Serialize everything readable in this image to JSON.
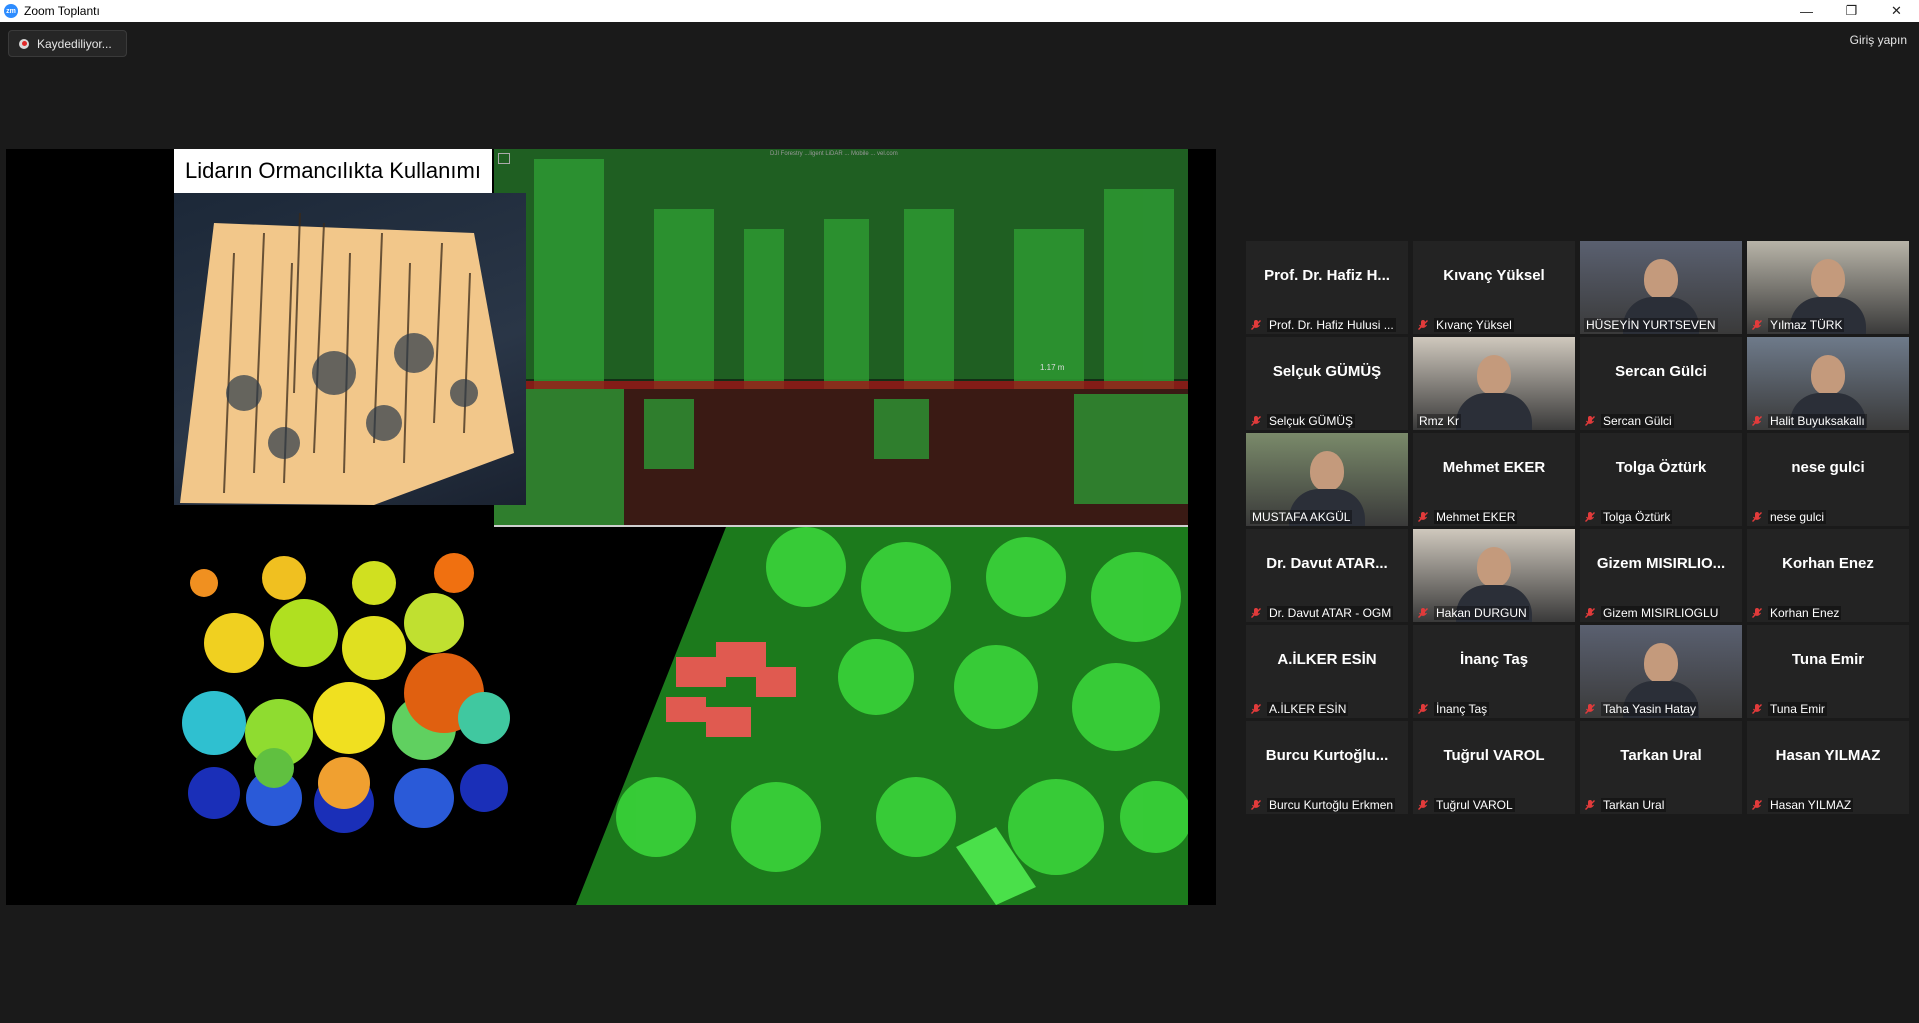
{
  "window": {
    "title": "Zoom Toplantı",
    "logo_text": "zm"
  },
  "window_controls": {
    "minimize": "—",
    "restore": "❐",
    "close": "✕"
  },
  "topbar": {
    "recording_label": "Kaydediliyor...",
    "signin_label": "Giriş yapın"
  },
  "share": {
    "slide_title": "Lidarın Ormancılıkta Kullanımı",
    "measure_label": "1.17 m",
    "top_caption": "DJI Forestry ...ligent LiDAR ... Mobile ... vel.com"
  },
  "participants": [
    {
      "display": "Prof. Dr. Hafiz H...",
      "name": "Prof. Dr. Hafiz Hulusi ...",
      "video": false,
      "muted": true
    },
    {
      "display": "Kıvanç Yüksel",
      "name": "Kıvanç Yüksel",
      "video": false,
      "muted": true
    },
    {
      "display": "",
      "name": "HÜSEYİN YURTSEVEN",
      "video": true,
      "muted": false,
      "speaking": true
    },
    {
      "display": "",
      "name": "Yılmaz TÜRK",
      "video": true,
      "muted": true
    },
    {
      "display": "Selçuk GÜMÜŞ",
      "name": "Selçuk GÜMÜŞ",
      "video": false,
      "muted": true
    },
    {
      "display": "",
      "name": "Rmz Kr",
      "video": true,
      "muted": false
    },
    {
      "display": "Sercan Gülci",
      "name": "Sercan Gülci",
      "video": false,
      "muted": true
    },
    {
      "display": "",
      "name": "Halit Buyuksakallı",
      "video": true,
      "muted": true
    },
    {
      "display": "",
      "name": "MUSTAFA AKGÜL",
      "video": true,
      "muted": false
    },
    {
      "display": "Mehmet EKER",
      "name": "Mehmet EKER",
      "video": false,
      "muted": true
    },
    {
      "display": "Tolga Öztürk",
      "name": "Tolga Öztürk",
      "video": false,
      "muted": true
    },
    {
      "display": "nese gulci",
      "name": "nese gulci",
      "video": false,
      "muted": true
    },
    {
      "display": "Dr. Davut ATAR...",
      "name": "Dr. Davut ATAR - OGM",
      "video": false,
      "muted": true
    },
    {
      "display": "",
      "name": "Hakan DURGUN",
      "video": true,
      "muted": true
    },
    {
      "display": "Gizem MISIRLIO...",
      "name": "Gizem MISIRLIOGLU",
      "video": false,
      "muted": true
    },
    {
      "display": "Korhan Enez",
      "name": "Korhan Enez",
      "video": false,
      "muted": true
    },
    {
      "display": "A.İLKER ESİN",
      "name": "A.İLKER ESİN",
      "video": false,
      "muted": true
    },
    {
      "display": "İnanç Taş",
      "name": "İnanç Taş",
      "video": false,
      "muted": true
    },
    {
      "display": "",
      "name": "Taha Yasin Hatay",
      "video": true,
      "muted": true
    },
    {
      "display": "Tuna Emir",
      "name": "Tuna Emir",
      "video": false,
      "muted": true
    },
    {
      "display": "Burcu Kurtoğlu...",
      "name": "Burcu Kurtoğlu Erkmen",
      "video": false,
      "muted": true
    },
    {
      "display": "Tuğrul VAROL",
      "name": "Tuğrul VAROL",
      "video": false,
      "muted": true
    },
    {
      "display": "Tarkan Ural",
      "name": "Tarkan Ural",
      "video": false,
      "muted": true
    },
    {
      "display": "Hasan YILMAZ",
      "name": "Hasan YILMAZ",
      "video": false,
      "muted": true
    }
  ]
}
